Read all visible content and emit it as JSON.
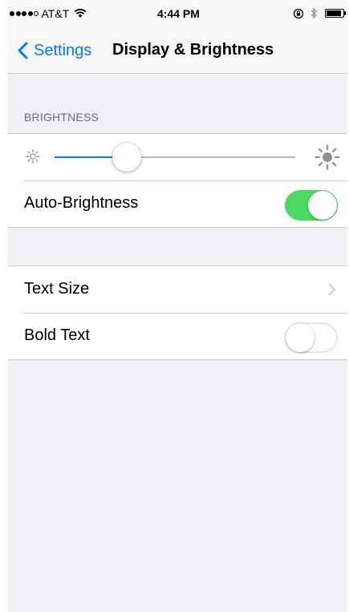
{
  "status_bar": {
    "signal_dots": [
      true,
      true,
      true,
      true,
      false
    ],
    "carrier": "AT&T",
    "time": "4:44 PM",
    "icons": [
      "wifi-icon",
      "orientation-lock-icon",
      "bluetooth-icon",
      "battery-icon"
    ]
  },
  "nav": {
    "back_label": "Settings",
    "title": "Display & Brightness"
  },
  "brightness": {
    "header": "BRIGHTNESS",
    "level": 0.3,
    "auto_label": "Auto-Brightness",
    "auto_on": true
  },
  "text_settings": {
    "text_size_label": "Text Size",
    "bold_label": "Bold Text",
    "bold_on": false
  },
  "colors": {
    "accent": "#007aff",
    "toggle_on": "#4cd964",
    "background": "#efeff4"
  }
}
